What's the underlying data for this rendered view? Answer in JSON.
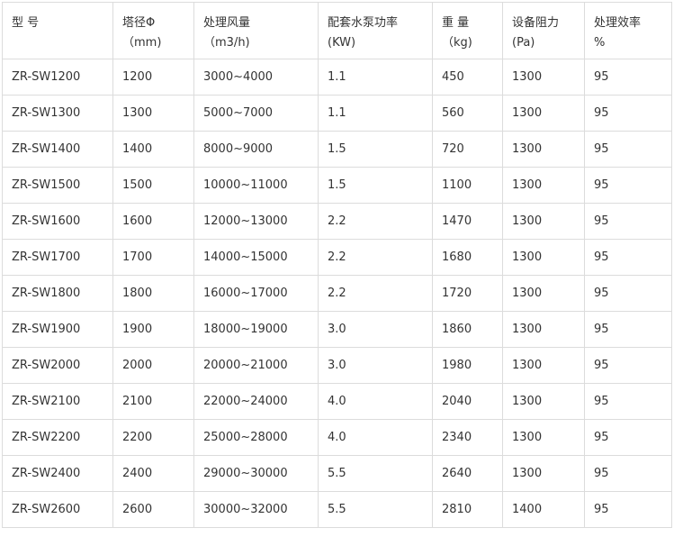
{
  "table": {
    "headers": [
      {
        "line1": "型  号",
        "line2": ""
      },
      {
        "line1": "塔径Φ",
        "line2": "（mm)"
      },
      {
        "line1": "处理风量",
        "line2": "（m3/h)"
      },
      {
        "line1": "配套水泵功率",
        "line2": "(KW)"
      },
      {
        "line1": "重  量",
        "line2": "（kg)"
      },
      {
        "line1": "设备阻力",
        "line2": "(Pa)"
      },
      {
        "line1": "处理效率",
        "line2": "%"
      }
    ],
    "rows": [
      [
        "ZR-SW1200",
        "1200",
        "3000~4000",
        "1.1",
        "450",
        "1300",
        "95"
      ],
      [
        "ZR-SW1300",
        "1300",
        "5000~7000",
        "1.1",
        "560",
        "1300",
        "95"
      ],
      [
        "ZR-SW1400",
        "1400",
        "8000~9000",
        "1.5",
        "720",
        "1300",
        "95"
      ],
      [
        "ZR-SW1500",
        "1500",
        "10000~11000",
        "1.5",
        "1100",
        "1300",
        "95"
      ],
      [
        "ZR-SW1600",
        "1600",
        "12000~13000",
        "2.2",
        "1470",
        "1300",
        "95"
      ],
      [
        "ZR-SW1700",
        "1700",
        "14000~15000",
        "2.2",
        "1680",
        "1300",
        "95"
      ],
      [
        "ZR-SW1800",
        "1800",
        "16000~17000",
        "2.2",
        "1720",
        "1300",
        "95"
      ],
      [
        "ZR-SW1900",
        "1900",
        "18000~19000",
        "3.0",
        "1860",
        "1300",
        "95"
      ],
      [
        "ZR-SW2000",
        "2000",
        "20000~21000",
        "3.0",
        "1980",
        "1300",
        "95"
      ],
      [
        "ZR-SW2100",
        "2100",
        "22000~24000",
        "4.0",
        "2040",
        "1300",
        "95"
      ],
      [
        "ZR-SW2200",
        "2200",
        "25000~28000",
        "4.0",
        "2340",
        "1300",
        "95"
      ],
      [
        "ZR-SW2400",
        "2400",
        "29000~30000",
        "5.5",
        "2640",
        "1300",
        "95"
      ],
      [
        "ZR-SW2600",
        "2600",
        "30000~32000",
        "5.5",
        "2810",
        "1400",
        "95"
      ]
    ]
  }
}
